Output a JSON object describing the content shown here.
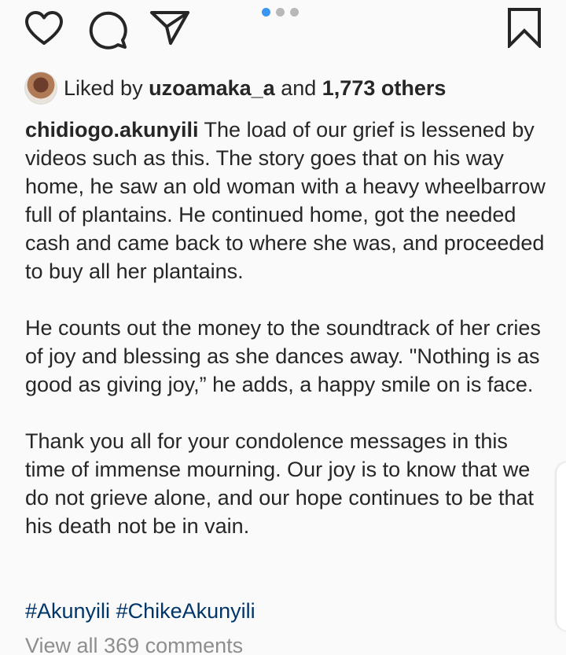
{
  "actions": {
    "like_icon": "heart-outline",
    "comment_icon": "speech-bubble",
    "share_icon": "paper-plane",
    "save_icon": "bookmark-outline"
  },
  "carousel": {
    "total": 3,
    "active_index": 0,
    "active_color": "#3897f0",
    "inactive_color": "#b8b8b8"
  },
  "likes": {
    "prefix": "Liked by",
    "user": "uzoamaka_a",
    "conjunction": "and",
    "others": "1,773 others"
  },
  "caption": {
    "username": "chidiogo.akunyili",
    "paragraph1": "The load of our grief is lessened by videos such as this. The story goes that on his way home, he saw an old woman with a heavy wheelbarrow full of plantains. He continued home, got the needed cash and came back to where she was, and proceeded to buy all her plantains.",
    "paragraph2": "He counts out the money to the soundtrack of her cries of joy and blessing as she dances away. \"Nothing is as good as giving joy,” he adds, a happy smile on is face.",
    "paragraph3": "Thank you all for your condolence messages in this time of immense mourning. Our joy is to know that we do not grieve alone, and our hope continues to be that his death not be in vain."
  },
  "hashtags": [
    "#Akunyili",
    "#ChikeAkunyili"
  ],
  "comments": {
    "view_all": "View all 369 comments"
  },
  "colors": {
    "background": "#fafafa",
    "text": "#262626",
    "hashtag": "#003569",
    "muted": "#8e8e8e"
  }
}
